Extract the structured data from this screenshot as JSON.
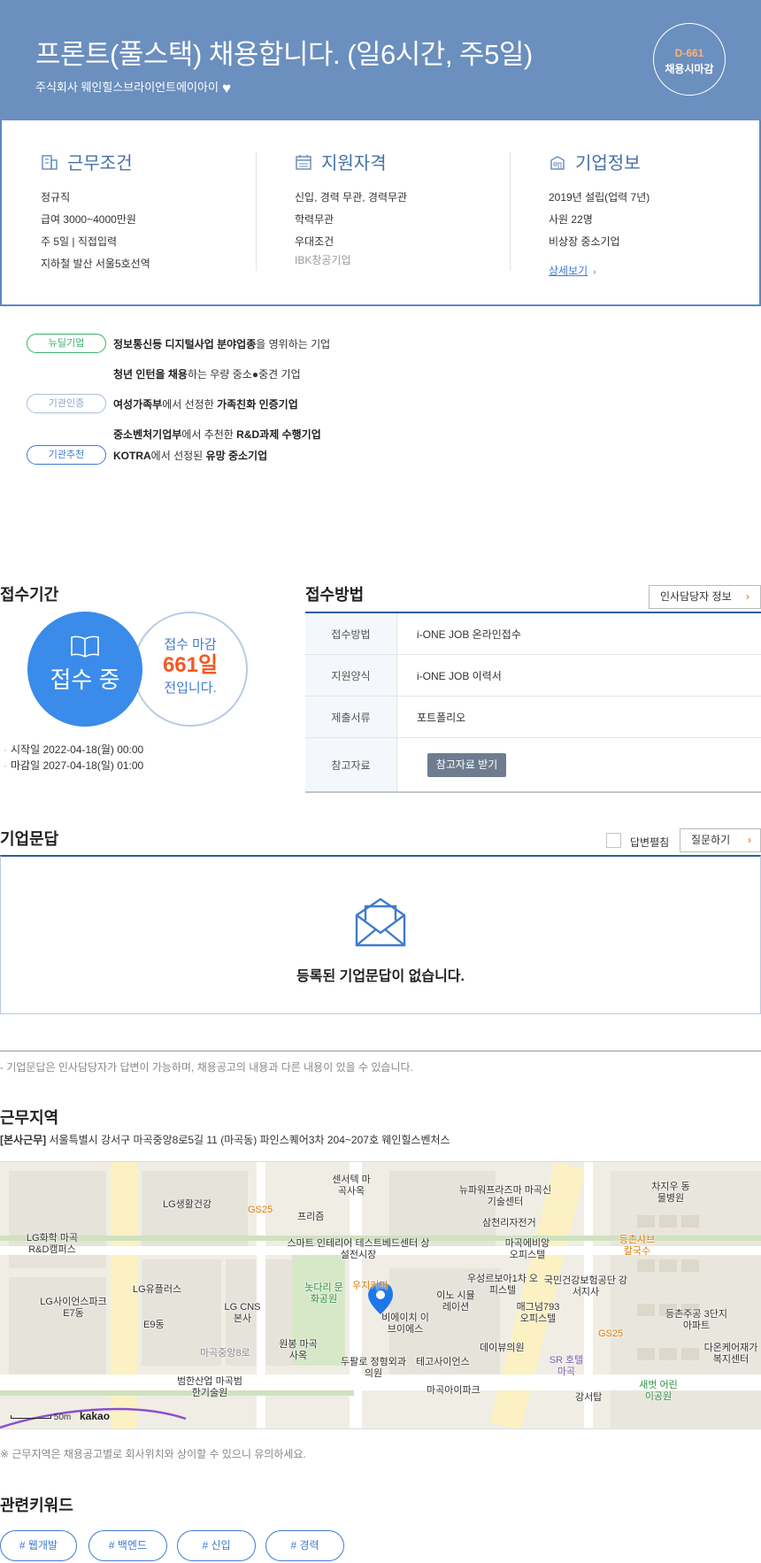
{
  "header": {
    "title": "프론트(풀스택) 채용합니다. (일6시간, 주5일)",
    "company": "주식회사 웨인힐스브라이언트에이아이",
    "dday": "D-661",
    "dday_label": "채용시마감"
  },
  "info": {
    "work": {
      "title": "근무조건",
      "items": [
        "정규직",
        "급여 3000~4000만원",
        "주 5일 | 직접입력",
        "지하철 발산 서울5호선역"
      ]
    },
    "qualification": {
      "title": "지원자격",
      "items": [
        "신입, 경력 무관, 경력무관",
        "학력무관",
        "우대조건"
      ],
      "sub": "IBK창공기업"
    },
    "company": {
      "title": "기업정보",
      "items": [
        "2019년 설립(업력 7년)",
        "사원 22명",
        "비상장 중소기업"
      ],
      "more": "상세보기"
    }
  },
  "badges": {
    "newdeal": "뉴딜기업",
    "cert": "기관인증",
    "recommend": "기관추천",
    "line1_b": "정보통신등 디지털사업 분야업종",
    "line1_t": "을 영위하는 기업",
    "line2_b": "청년 인턴을 채용",
    "line2_t": "하는 우량 중소●중견 기업",
    "line3_b1": "여성가족부",
    "line3_t1": "에서 선정한 ",
    "line3_b2": "가족친화 인증기업",
    "line4_b1": "중소벤처기업부",
    "line4_t1": "에서 추천한 ",
    "line4_b2": "R&D과제 수행기업",
    "line5_b1": "KOTRA",
    "line5_t1": "에서 선정된 ",
    "line5_b2": "유망 중소기업"
  },
  "period": {
    "title": "접수기간",
    "status": "접수 중",
    "deadline_prefix": "접수 마감",
    "days": "661일",
    "deadline_suffix": "전입니다.",
    "start": "시작일 2022-04-18(월) 00:00",
    "end": "마감일 2027-04-18(일) 01:00"
  },
  "method": {
    "title": "접수방법",
    "hr_button": "인사담당자 정보",
    "rows": [
      {
        "head": "접수방법",
        "value": "i-ONE JOB 온라인접수"
      },
      {
        "head": "지원양식",
        "value": "i-ONE JOB 이력서"
      },
      {
        "head": "제출서류",
        "value": "포트폴리오"
      },
      {
        "head": "참고자료",
        "value": "참고자료 받기"
      }
    ]
  },
  "qa": {
    "title": "기업문답",
    "checkbox_label": "답변펼침",
    "ask_button": "질문하기",
    "empty": "등록된 기업문답이 없습니다.",
    "note": "- 기업문답은 인사담당자가 답변이 가능하며, 채용공고의 내용과 다른 내용이 있을 수 있습니다."
  },
  "location": {
    "title": "근무지역",
    "addr_label": "[본사근무]",
    "address": " 서울특별시 강서구 마곡중앙8로5길 11 (마곡동) 파인스퀘어3차 204~207호 웨인힐스벤처스",
    "scale": "50m",
    "map_brand": "kakao",
    "note": "※ 근무지역은 채용공고별로 회사위치와 상이할 수 있으니 유의하세요.",
    "map_labels": [
      "LG생활건강",
      "GS25",
      "프리즘",
      "센서텍 마곡사옥",
      "뉴파워프라즈마 마곡신기술센터",
      "삼천리자전거",
      "스마트 인테리어 테스트베드센터 상설전시장",
      "LG화학 마곡R&D캠퍼스",
      "LG유플러스",
      "LG사이언스파크 E7동",
      "E9동",
      "LG CNS 본사",
      "놋다리 문화공원",
      "우지커피",
      "이노 시뮬레이션",
      "우성르보아1차 오피스텔",
      "마곡에비앙 오피스텔",
      "국민건강보험공단 강서지사",
      "매그넘793 오피스텔",
      "비에이치 이브이에스",
      "원봉 마곡사옥",
      "두팔로 정형외과의원",
      "테고사이언스",
      "데이뷰의원",
      "SR 호텔 마곡",
      "마곡아이파크",
      "범한산업 마곡범한기술원",
      "등촌샤브 칼국수",
      "등촌주공 3단지아파트",
      "다온케어재가 복지센터",
      "새벗 어린이공원",
      "차지우 동물병원",
      "GS25",
      "강서탑",
      "마곡중앙8로"
    ]
  },
  "keywords": {
    "title": "관련키워드",
    "items": [
      "# 웹개발",
      "# 백엔드",
      "# 신입",
      "# 경력"
    ]
  },
  "colors": {
    "hero": "#6b8fbe",
    "accent_blue": "#3f7bd0",
    "accent_orange": "#f15a22",
    "status_circle": "#3a8bea"
  }
}
